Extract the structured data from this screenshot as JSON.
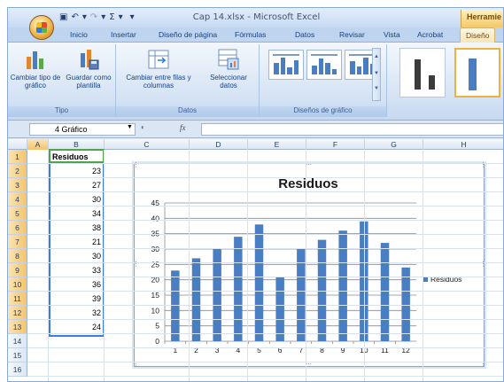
{
  "window": {
    "title": "Cap 14.xlsx - Microsoft Excel",
    "contextual_tab": "Herramie"
  },
  "ribbon": {
    "tabs": [
      "Inicio",
      "Insertar",
      "Diseño de página",
      "Fórmulas",
      "Datos",
      "Revisar",
      "Vista",
      "Acrobat",
      "Diseño"
    ],
    "active_tab": "Diseño",
    "groups": {
      "tipo": {
        "label": "Tipo",
        "buttons": [
          "Cambiar tipo de gráfico",
          "Guardar como plantilla"
        ]
      },
      "datos": {
        "label": "Datos",
        "buttons": [
          "Cambiar entre filas y columnas",
          "Seleccionar datos"
        ]
      },
      "disenos": {
        "label": "Diseños de gráfico"
      }
    }
  },
  "formula_bar": {
    "name_box": "4 Gráfico",
    "fx": "fx",
    "formula": ""
  },
  "sheet": {
    "columns": [
      "A",
      "B",
      "C",
      "D",
      "E",
      "F",
      "G",
      "H"
    ],
    "rows": [
      "1",
      "2",
      "3",
      "4",
      "5",
      "6",
      "7",
      "8",
      "9",
      "10",
      "11",
      "12",
      "13",
      "14",
      "15",
      "16"
    ],
    "column_a": [
      "Residuos",
      "23",
      "27",
      "30",
      "34",
      "38",
      "21",
      "30",
      "33",
      "36",
      "39",
      "32",
      "24"
    ]
  },
  "chart_data": {
    "type": "bar",
    "title": "Residuos",
    "categories": [
      "1",
      "2",
      "3",
      "4",
      "5",
      "6",
      "7",
      "8",
      "9",
      "10",
      "11",
      "12"
    ],
    "series": [
      {
        "name": "Residuos",
        "values": [
          23,
          27,
          30,
          34,
          38,
          21,
          30,
          33,
          36,
          39,
          32,
          24
        ]
      }
    ],
    "ylim": [
      0,
      45
    ],
    "yticks": [
      "0",
      "5",
      "10",
      "15",
      "20",
      "25",
      "30",
      "35",
      "40",
      "45"
    ],
    "grid": true,
    "legend_position": "right",
    "bar_color": "#4a7ec2"
  }
}
